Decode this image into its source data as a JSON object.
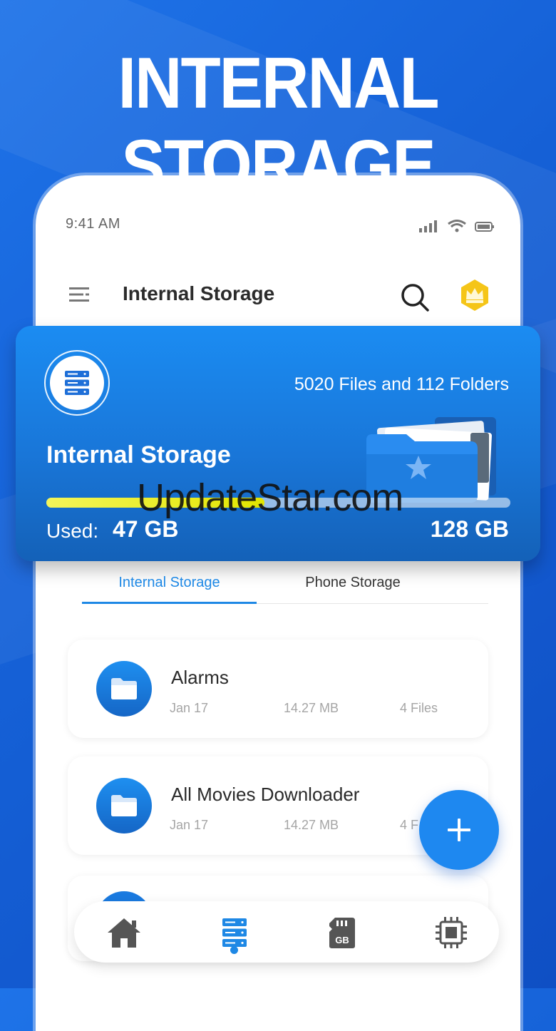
{
  "headline": "INTERNAL STORAGE",
  "status_bar": {
    "time": "9:41 AM"
  },
  "app_bar": {
    "title": "Internal Storage"
  },
  "storage_card": {
    "count_text": "5020 Files and 112 Folders",
    "title": "Internal Storage",
    "used_label": "Used:",
    "used_value": "47 GB",
    "total_value": "128 GB",
    "used_fraction": 0.47,
    "watermark": "UpdateStar.com"
  },
  "tabs": [
    {
      "label": "Internal Storage",
      "active": true
    },
    {
      "label": "Phone Storage",
      "active": false
    }
  ],
  "files": [
    {
      "name": "Alarms",
      "date": "Jan 17",
      "size": "14.27 MB",
      "count": "4 Files"
    },
    {
      "name": "All Movies Downloader",
      "date": "Jan 17",
      "size": "14.27 MB",
      "count": "4 F"
    }
  ],
  "bottom_nav": [
    {
      "icon": "home-icon",
      "active": false
    },
    {
      "icon": "storage-icon",
      "active": true
    },
    {
      "icon": "sd-card-icon",
      "label": "GB",
      "active": false
    },
    {
      "icon": "chip-icon",
      "active": false
    }
  ],
  "colors": {
    "accent": "#1e88e5",
    "progress": "#e2e600",
    "card": "#1976d8"
  }
}
